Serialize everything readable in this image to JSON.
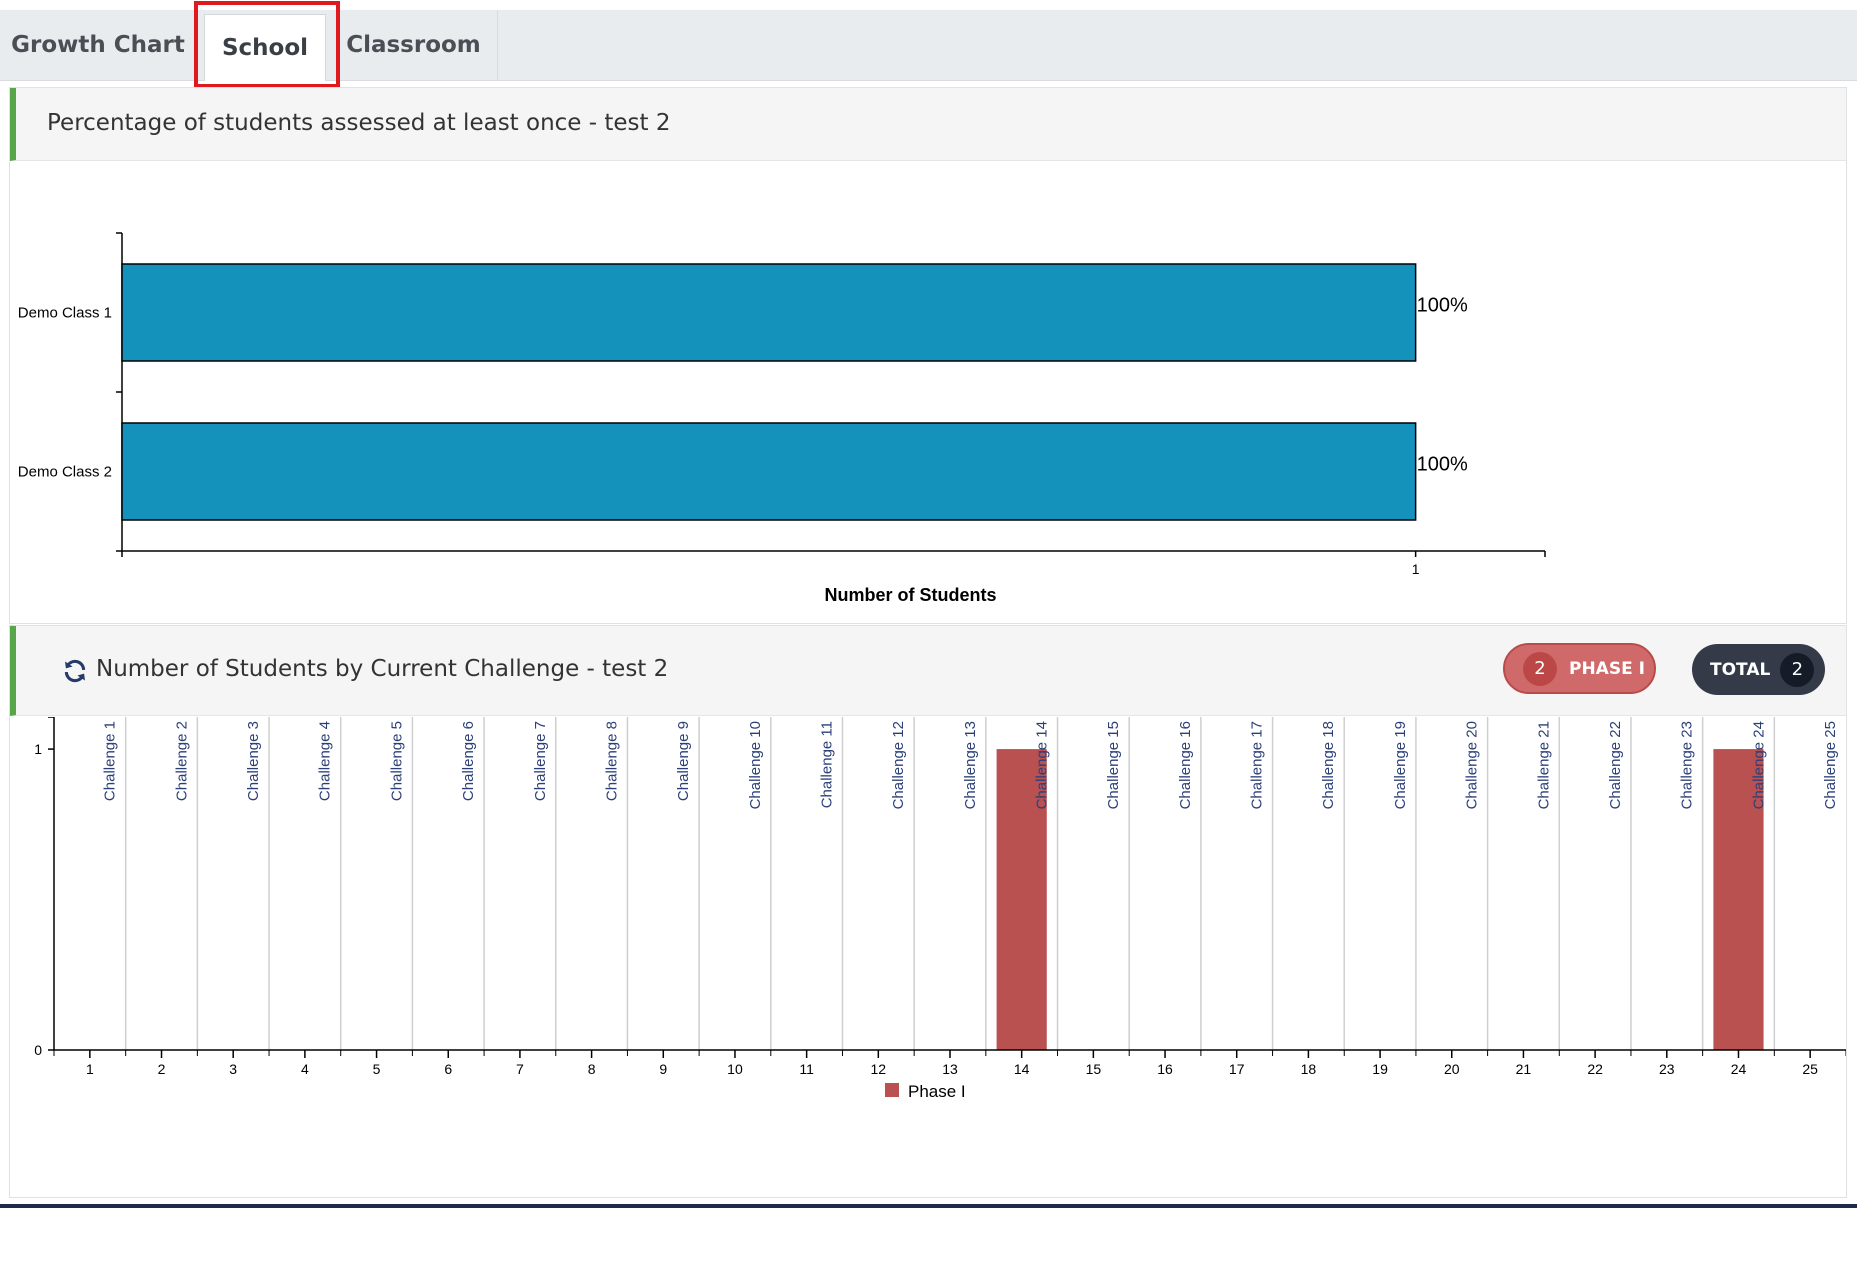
{
  "tabs": [
    "Growth Chart",
    "School",
    "Classroom"
  ],
  "active_tab": "School",
  "panel1": {
    "title": "Percentage of students assessed at least once - test 2"
  },
  "panel2": {
    "title": "Number of Students by Current Challenge - test 2",
    "badges": {
      "phase": {
        "count": "2",
        "label": "PHASE I",
        "color": "#d06a6a"
      },
      "total": {
        "count": "2",
        "label": "TOTAL",
        "color": "#343a48"
      }
    }
  },
  "chart_data": [
    {
      "type": "bar",
      "orientation": "horizontal",
      "categories": [
        "Demo Class 1",
        "Demo Class 2"
      ],
      "values": [
        1,
        1
      ],
      "data_labels": [
        "100%",
        "100%"
      ],
      "xlabel": "Number of Students",
      "ylabel": "",
      "xticks": [
        "1"
      ],
      "xlim": [
        0,
        1.1
      ],
      "bar_color": "#1592bb",
      "grid": false
    },
    {
      "type": "bar",
      "categories": [
        "1",
        "2",
        "3",
        "4",
        "5",
        "6",
        "7",
        "8",
        "9",
        "10",
        "11",
        "12",
        "13",
        "14",
        "15",
        "16",
        "17",
        "18",
        "19",
        "20",
        "21",
        "22",
        "23",
        "24",
        "25"
      ],
      "category_labels": [
        "Challenge 1",
        "Challenge 2",
        "Challenge 3",
        "Challenge 4",
        "Challenge 5",
        "Challenge 6",
        "Challenge 7",
        "Challenge 8",
        "Challenge 9",
        "Challenge 10",
        "Challenge 11",
        "Challenge 12",
        "Challenge 13",
        "Challenge 14",
        "Challenge 15",
        "Challenge 16",
        "Challenge 17",
        "Challenge 18",
        "Challenge 19",
        "Challenge 20",
        "Challenge 21",
        "Challenge 22",
        "Challenge 23",
        "Challenge 24",
        "Challenge 25"
      ],
      "series": [
        {
          "name": "Phase I",
          "color": "#b85150",
          "values": [
            0,
            0,
            0,
            0,
            0,
            0,
            0,
            0,
            0,
            0,
            0,
            0,
            0,
            1,
            0,
            0,
            0,
            0,
            0,
            0,
            0,
            0,
            0,
            1,
            0
          ]
        }
      ],
      "yticks": [
        "0",
        "1"
      ],
      "ylim": [
        0,
        1.1
      ],
      "legend": "bottom-center",
      "grid": false
    }
  ]
}
